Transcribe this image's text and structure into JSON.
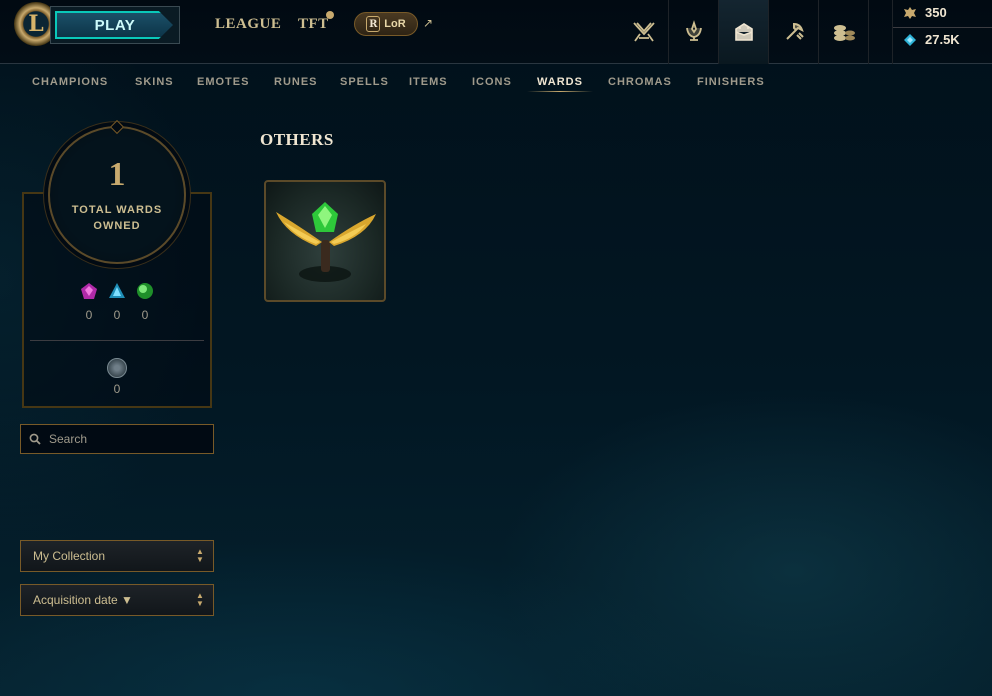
{
  "topbar": {
    "logo_letter": "L",
    "play_label": "PLAY",
    "nav": [
      {
        "label": "LEAGUE"
      },
      {
        "label": "TFT"
      },
      {
        "label": "LoR"
      }
    ],
    "lor_badge": "R",
    "external_arrow": "↗",
    "icons": [
      "clash-icon",
      "ranked-icon",
      "collection-icon",
      "loot-icon",
      "store-icon"
    ],
    "currency": {
      "rp": "350",
      "be": "27.5K"
    }
  },
  "subnav": {
    "items": [
      "CHAMPIONS",
      "SKINS",
      "EMOTES",
      "RUNES",
      "SPELLS",
      "ITEMS",
      "ICONS",
      "WARDS",
      "CHROMAS",
      "FINISHERS"
    ],
    "active": "WARDS"
  },
  "stats": {
    "total": "1",
    "label": "TOTAL WARDS OWNED",
    "gems": [
      {
        "name": "mythic",
        "count": "0",
        "color": "#c83cb4"
      },
      {
        "name": "legendary",
        "count": "0",
        "color": "#2fb4d8"
      },
      {
        "name": "epic",
        "count": "0",
        "color": "#3ec84a"
      }
    ],
    "token_count": "0"
  },
  "filters": {
    "search_placeholder": "Search",
    "collection": "My Collection",
    "sort": "Acquisition date ▼"
  },
  "main": {
    "section_title": "OTHERS",
    "wards": [
      {
        "name": "winged-ward"
      }
    ]
  },
  "colors": {
    "gold": "#c8aa6e",
    "teal": "#0ac8b9",
    "background": "#010a13"
  }
}
